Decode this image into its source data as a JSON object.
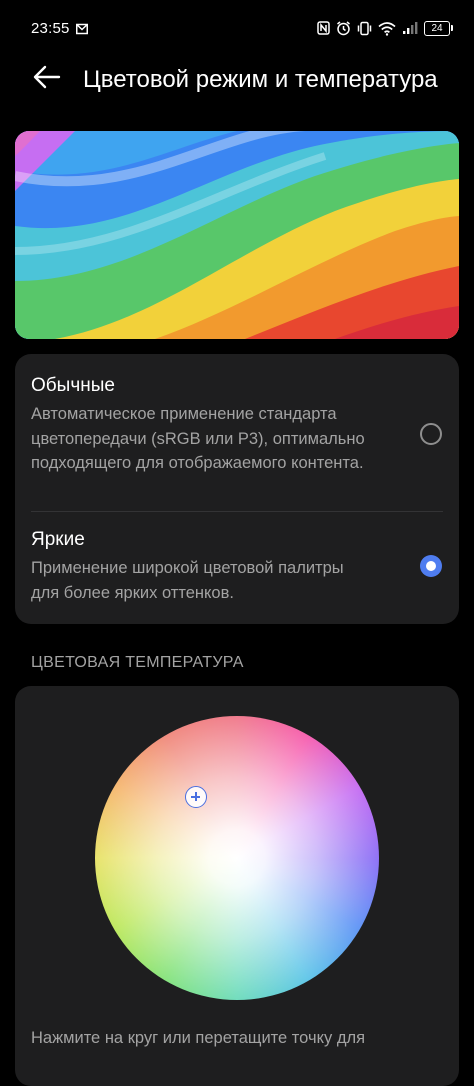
{
  "status_bar": {
    "time": "23:55",
    "battery": "24",
    "icons": [
      "mail-icon",
      "nfc-icon",
      "alarm-icon",
      "vibrate-icon",
      "wifi-icon",
      "signal-icon",
      "battery-icon"
    ]
  },
  "header": {
    "title": "Цветовой режим и температура",
    "back_icon": "back-arrow-icon"
  },
  "modes": [
    {
      "title": "Обычные",
      "description": "Автоматическое применение стандарта цветопередачи (sRGB или P3), оптимально подходящего для отображаемого контента.",
      "selected": false
    },
    {
      "title": "Яркие",
      "description": "Применение широкой цветовой палитры для более ярких оттенков.",
      "selected": true
    }
  ],
  "temperature": {
    "section_title": "ЦВЕТОВАЯ ТЕМПЕРАТУРА",
    "hint": "Нажмите на круг или перетащите точку для"
  },
  "colors": {
    "accent": "#4f7df0",
    "card_background": "#1e1e1f",
    "secondary_text": "#a3a3a3"
  }
}
